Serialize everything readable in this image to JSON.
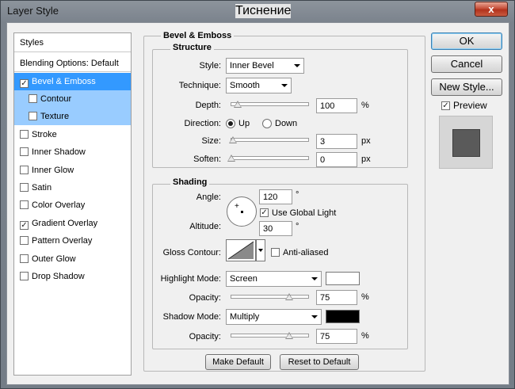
{
  "window": {
    "title": "Layer Style",
    "close_glyph": "x"
  },
  "overlay_caption": "Тиснение",
  "styles_panel": {
    "header": "Styles",
    "blending_options": "Blending Options: Default",
    "items": [
      {
        "label": "Bevel & Emboss",
        "checked": true,
        "selected": true
      },
      {
        "label": "Contour",
        "checked": false,
        "sub": true
      },
      {
        "label": "Texture",
        "checked": false,
        "sub": true
      },
      {
        "label": "Stroke",
        "checked": false
      },
      {
        "label": "Inner Shadow",
        "checked": false
      },
      {
        "label": "Inner Glow",
        "checked": false
      },
      {
        "label": "Satin",
        "checked": false
      },
      {
        "label": "Color Overlay",
        "checked": false
      },
      {
        "label": "Gradient Overlay",
        "checked": true
      },
      {
        "label": "Pattern Overlay",
        "checked": false
      },
      {
        "label": "Outer Glow",
        "checked": false
      },
      {
        "label": "Drop Shadow",
        "checked": false
      }
    ]
  },
  "bevel": {
    "group_title": "Bevel & Emboss",
    "structure": {
      "title": "Structure",
      "style_label": "Style:",
      "style_value": "Inner Bevel",
      "technique_label": "Technique:",
      "technique_value": "Smooth",
      "depth_label": "Depth:",
      "depth_value": "100",
      "depth_unit": "%",
      "depth_slider_fraction": 0.08,
      "direction_label": "Direction:",
      "direction_up": "Up",
      "direction_down": "Down",
      "size_label": "Size:",
      "size_value": "3",
      "size_unit": "px",
      "size_slider_fraction": 0.02,
      "soften_label": "Soften:",
      "soften_value": "0",
      "soften_unit": "px",
      "soften_slider_fraction": 0.0
    },
    "shading": {
      "title": "Shading",
      "angle_label": "Angle:",
      "angle_value": "120",
      "angle_unit": "°",
      "use_global_light": "Use Global Light",
      "altitude_label": "Altitude:",
      "altitude_value": "30",
      "altitude_unit": "°",
      "gloss_contour_label": "Gloss Contour:",
      "anti_aliased": "Anti-aliased",
      "highlight_mode_label": "Highlight Mode:",
      "highlight_mode_value": "Screen",
      "highlight_color": "#ffffff",
      "highlight_opacity_label": "Opacity:",
      "highlight_opacity_value": "75",
      "highlight_opacity_unit": "%",
      "highlight_opacity_fraction": 0.75,
      "shadow_mode_label": "Shadow Mode:",
      "shadow_mode_value": "Multiply",
      "shadow_color": "#000000",
      "shadow_opacity_label": "Opacity:",
      "shadow_opacity_value": "75",
      "shadow_opacity_unit": "%",
      "shadow_opacity_fraction": 0.75
    },
    "make_default": "Make Default",
    "reset_default": "Reset to Default"
  },
  "actions": {
    "ok": "OK",
    "cancel": "Cancel",
    "new_style": "New Style...",
    "preview": "Preview"
  },
  "check_glyph": "✓"
}
